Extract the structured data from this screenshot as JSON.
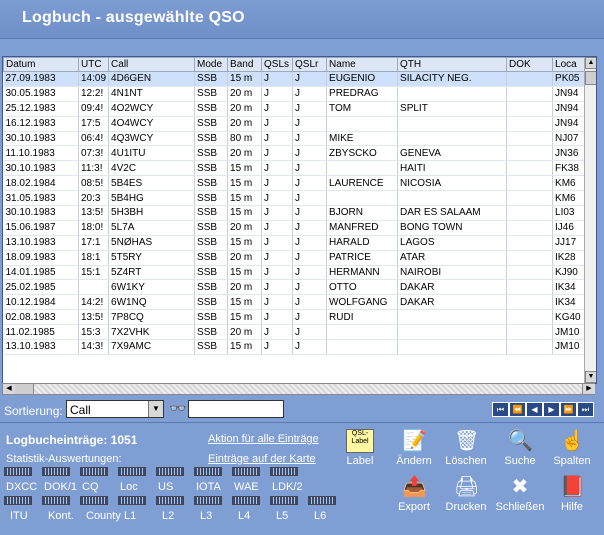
{
  "title": "Logbuch - ausgewählte QSO",
  "columns": [
    "Datum",
    "UTC",
    "Call",
    "Mode",
    "Band",
    "QSLs",
    "QSLr",
    "Name",
    "QTH",
    "DOK",
    "Loca"
  ],
  "rows": [
    [
      "27.09.1983",
      "14:09",
      "4D6GEN",
      "SSB",
      "15 m",
      "J",
      "J",
      "EUGENIO",
      "SILACITY NEG.",
      "",
      "PK05"
    ],
    [
      "30.05.1983",
      "12:2!",
      "4N1NT",
      "SSB",
      "20 m",
      "J",
      "J",
      "PREDRAG",
      "",
      "",
      "JN94"
    ],
    [
      "25.12.1983",
      "09:4!",
      "4O2WCY",
      "SSB",
      "20 m",
      "J",
      "J",
      "TOM",
      "SPLIT",
      "",
      "JN94"
    ],
    [
      "16.12.1983",
      "17:5",
      "4O4WCY",
      "SSB",
      "20 m",
      "J",
      "J",
      "",
      "",
      "",
      "JN94"
    ],
    [
      "30.10.1983",
      "06:4!",
      "4Q3WCY",
      "SSB",
      "80 m",
      "J",
      "J",
      "MIKE",
      "",
      "",
      "NJ07"
    ],
    [
      "11.10.1983",
      "07:3!",
      "4U1ITU",
      "SSB",
      "20 m",
      "J",
      "J",
      "ZBYSCKO",
      "GENEVA",
      "",
      "JN36"
    ],
    [
      "30.10.1983",
      "11:3!",
      "4V2C",
      "SSB",
      "15 m",
      "J",
      "J",
      "",
      "HAITI",
      "",
      "FK38"
    ],
    [
      "18.02.1984",
      "08:5!",
      "5B4ES",
      "SSB",
      "15 m",
      "J",
      "J",
      "LAURENCE",
      "NICOSIA",
      "",
      "KM6"
    ],
    [
      "31.05.1983",
      "20:3",
      "5B4HG",
      "SSB",
      "15 m",
      "J",
      "J",
      "",
      "",
      "",
      "KM6"
    ],
    [
      "30.10.1983",
      "13:5!",
      "5H3BH",
      "SSB",
      "15 m",
      "J",
      "J",
      "BJORN",
      "DAR ES SALAAM",
      "",
      "LI03"
    ],
    [
      "15.06.1987",
      "18:0!",
      "5L7A",
      "SSB",
      "20 m",
      "J",
      "J",
      "MANFRED",
      "BONG TOWN",
      "",
      "IJ46"
    ],
    [
      "13.10.1983",
      "17:1",
      "5NØHAS",
      "SSB",
      "15 m",
      "J",
      "J",
      "HARALD",
      "LAGOS",
      "",
      "JJ17"
    ],
    [
      "18.09.1983",
      "18:1",
      "5T5RY",
      "SSB",
      "20 m",
      "J",
      "J",
      "PATRICE",
      "ATAR",
      "",
      "IK28"
    ],
    [
      "14.01.1985",
      "15:1",
      "5Z4RT",
      "SSB",
      "15 m",
      "J",
      "J",
      "HERMANN",
      "NAIROBI",
      "",
      "KJ90"
    ],
    [
      "25.02.1985",
      "",
      "6W1KY",
      "SSB",
      "20 m",
      "J",
      "J",
      "OTTO",
      "DAKAR",
      "",
      "IK34"
    ],
    [
      "10.12.1984",
      "14:2!",
      "6W1NQ",
      "SSB",
      "15 m",
      "J",
      "J",
      "WOLFGANG",
      "DAKAR",
      "",
      "IK34"
    ],
    [
      "02.08.1983",
      "13:5!",
      "7P8CQ",
      "SSB",
      "15 m",
      "J",
      "J",
      "RUDI",
      "",
      "",
      "KG40"
    ],
    [
      "11.02.1985",
      "15:3",
      "7X2VHK",
      "SSB",
      "20 m",
      "J",
      "J",
      "",
      "",
      "",
      "JM10"
    ],
    [
      "13.10.1983",
      "14:3!",
      "7X9AMC",
      "SSB",
      "15 m",
      "J",
      "J",
      "",
      "",
      "",
      "JM10"
    ]
  ],
  "sort": {
    "label": "Sortierung:",
    "value": "Call"
  },
  "count_label": "Logbucheinträge:  1051",
  "stats_label": "Statistik-Auswertungen:",
  "link_all": "Aktion für alle Einträge",
  "link_map": "Einträge auf der Karte",
  "stats_row1": [
    "DXCC",
    "DOK/1",
    "CQ",
    "Loc",
    "US",
    "IOTA",
    "WAE",
    "LDK/2"
  ],
  "stats_row2": [
    "ITU",
    "Kont.",
    "County",
    "L1",
    "L2",
    "L3",
    "L4",
    "L5",
    "L6"
  ],
  "tools": [
    {
      "label": "Label",
      "icon": "qsl-label-icon"
    },
    {
      "label": "Ändern",
      "icon": "edit-icon"
    },
    {
      "label": "Löschen",
      "icon": "delete-icon"
    },
    {
      "label": "Suche",
      "icon": "search-icon"
    },
    {
      "label": "Spalten",
      "icon": "columns-icon"
    },
    {
      "label": "Export",
      "icon": "export-icon"
    },
    {
      "label": "Drucken",
      "icon": "print-icon"
    },
    {
      "label": "Schließen",
      "icon": "close-icon"
    },
    {
      "label": "Hilfe",
      "icon": "help-icon"
    }
  ],
  "qsl_icon_text": "QSL-Label"
}
